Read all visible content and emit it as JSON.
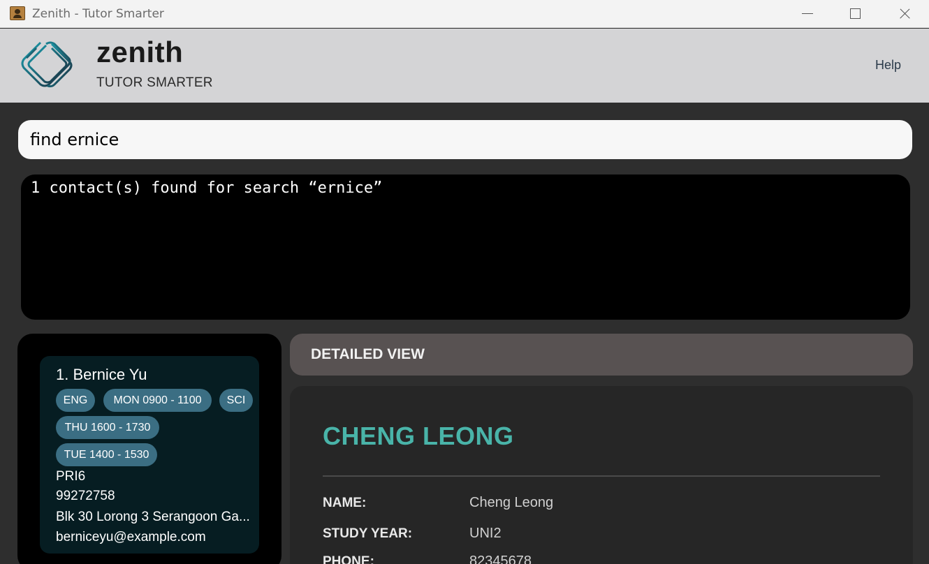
{
  "window": {
    "title": "Zenith - Tutor Smarter"
  },
  "header": {
    "brand": "zenith",
    "tagline": "TUTOR SMARTER",
    "help": "Help"
  },
  "command": {
    "value": "find ernice"
  },
  "result": {
    "text": "1 contact(s) found for search “ernice”"
  },
  "list": {
    "cards": [
      {
        "name": "1. Bernice Yu",
        "tags": [
          "ENG",
          "MON 0900 - 1100",
          "SCI",
          "THU 1600 - 1730",
          "TUE 1400 - 1530"
        ],
        "level": "PRI6",
        "phone": "99272758",
        "address": "Blk 30 Lorong 3 Serangoon Ga...",
        "email": "berniceyu@example.com"
      }
    ]
  },
  "detail": {
    "header": "DETAILED VIEW",
    "title": "CHENG LEONG",
    "rows": [
      {
        "label": "NAME:",
        "value": "Cheng Leong"
      },
      {
        "label": "STUDY YEAR:",
        "value": "UNI2"
      },
      {
        "label": "PHONE:",
        "value": "82345678"
      }
    ]
  },
  "colors": {
    "accent": "#49b4a9",
    "tag": "#3b6e83",
    "header": "#d4d4d6"
  }
}
